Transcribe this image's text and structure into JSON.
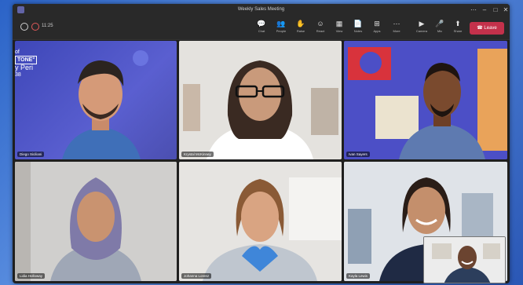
{
  "window": {
    "title": "Weekly Sales Meeting"
  },
  "toolbar": {
    "timer": "11:25",
    "buttons": [
      {
        "label": "Chat",
        "icon": "chat-icon",
        "glyph": "💬"
      },
      {
        "label": "People",
        "icon": "people-icon",
        "glyph": "👥"
      },
      {
        "label": "Raise",
        "icon": "raise-hand-icon",
        "glyph": "✋"
      },
      {
        "label": "React",
        "icon": "react-icon",
        "glyph": "☺"
      },
      {
        "label": "View",
        "icon": "view-icon",
        "glyph": "▦"
      },
      {
        "label": "Notes",
        "icon": "notes-icon",
        "glyph": "📄"
      },
      {
        "label": "Apps",
        "icon": "apps-icon",
        "glyph": "⊞"
      },
      {
        "label": "More",
        "icon": "more-icon",
        "glyph": "⋯"
      },
      {
        "label": "Camera",
        "icon": "camera-icon",
        "glyph": "▶"
      },
      {
        "label": "Mic",
        "icon": "mic-icon",
        "glyph": "🎤"
      },
      {
        "label": "Share",
        "icon": "share-icon",
        "glyph": "⬆"
      }
    ],
    "leave_label": "Leave"
  },
  "participants": [
    {
      "name": "Diego Siciliani"
    },
    {
      "name": "Krystal McKinney"
    },
    {
      "name": "Ivan Sayers"
    },
    {
      "name": "Lidia Holloway"
    },
    {
      "name": "Johanna Lorenz"
    },
    {
      "name": "Kayla Lewis"
    }
  ],
  "pantone": {
    "line1": "of",
    "line2": "TONE°",
    "line3": "y Peri",
    "line4": "38"
  }
}
